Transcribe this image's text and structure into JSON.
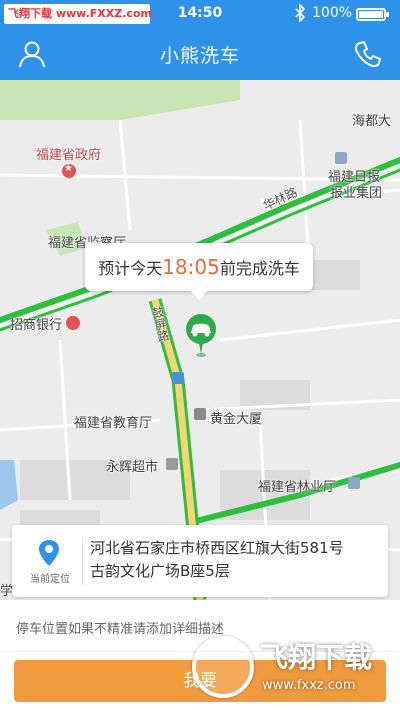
{
  "status_bar": {
    "watermark": "飞翔下载 www.FXXZ.com",
    "time": "14:50",
    "battery_text": "100%",
    "battery_level": 1.0
  },
  "header": {
    "title": "小熊洗车",
    "left_icon": "user-icon",
    "right_icon": "phone-icon"
  },
  "map": {
    "labels": {
      "hai_du": "海都大",
      "province_gov": "福建省政府",
      "fujian_daily": "福建日报",
      "newspaper_group": "报业集团",
      "hualin_road": "华林路",
      "procuratorate": "福建省监察厅",
      "cmb": "招商银行",
      "gupinglu": "鼓屏路",
      "education_dept": "福建省教育厅",
      "huangjin": "黄金大厦",
      "yonghui": "永辉超市",
      "forestry": "福建省林业厅",
      "xue": "学"
    },
    "colors": {
      "traffic_green": "#2fbf3f",
      "main_road_yellow": "#f7d47a",
      "park_green": "#c7e6b4",
      "water": "#9cc6ec"
    }
  },
  "eta_bubble": {
    "prefix": "预计今天",
    "time": "18:05",
    "suffix": "前完成洗车"
  },
  "location_card": {
    "pin_label": "当前定位",
    "address_line1": "河北省石家庄市桥西区红旗大街581号",
    "address_line2": "古韵文化广场B座5层"
  },
  "note": {
    "placeholder": "停车位置如果不精准请添加详细描述"
  },
  "submit": {
    "label": "我要"
  },
  "watermark_logo": {
    "brand": "飞翔下载",
    "site": "www.fxxz.com"
  },
  "accent_colors": {
    "header_blue": "#2e93e8",
    "submit_orange": "#f19a3e",
    "eta_orange": "#ef6a3a",
    "car_pin_green": "#2eaa4a"
  }
}
